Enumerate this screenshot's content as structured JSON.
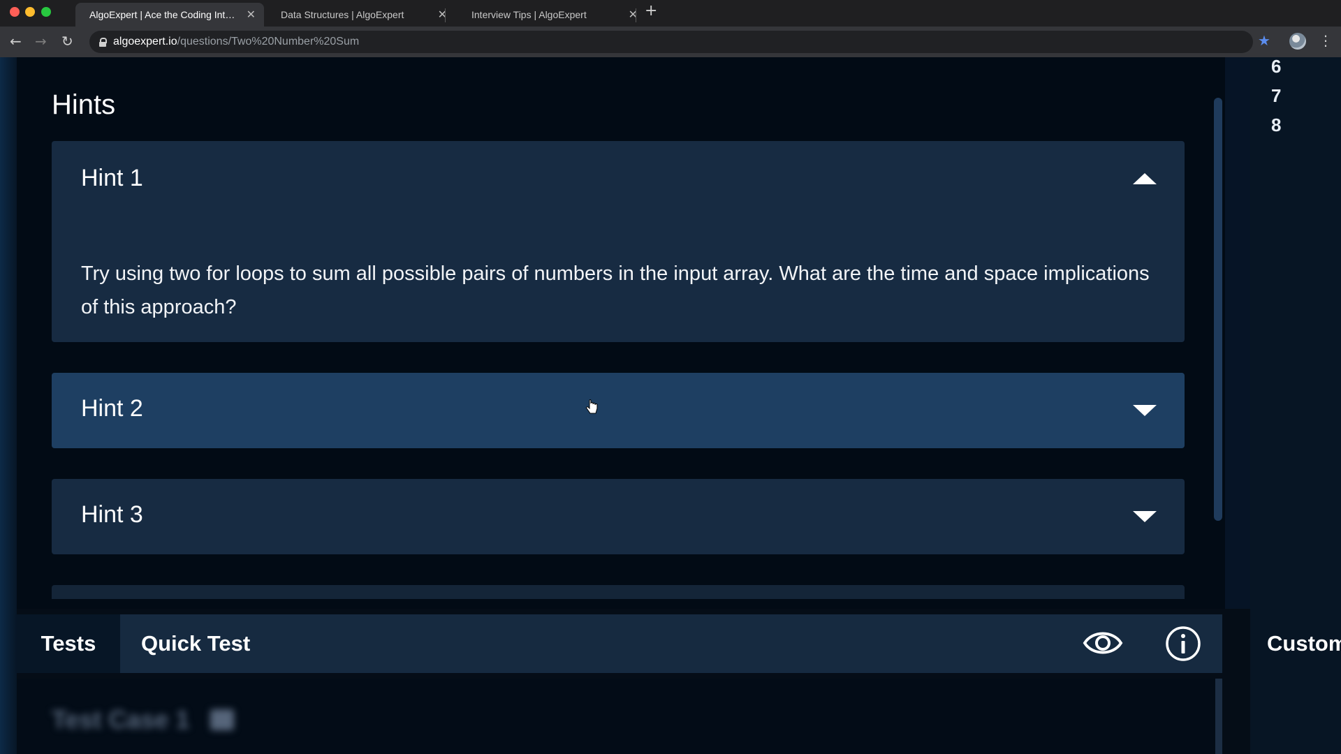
{
  "browser": {
    "tabs": [
      {
        "title": "AlgoExpert | Ace the Coding Interviews",
        "active": true
      },
      {
        "title": "Data Structures | AlgoExpert",
        "active": false
      },
      {
        "title": "Interview Tips | AlgoExpert",
        "active": false
      }
    ],
    "url_host": "algoexpert.io",
    "url_path": "/questions/Two%20Number%20Sum"
  },
  "hints": {
    "title": "Hints",
    "items": [
      {
        "label": "Hint 1",
        "expanded": true,
        "body": "Try using two for loops to sum all possible pairs of numbers in the input array. What are the time and space implications of this approach?"
      },
      {
        "label": "Hint 2",
        "expanded": false
      },
      {
        "label": "Hint 3",
        "expanded": false
      }
    ]
  },
  "editor": {
    "line_numbers": [
      "6",
      "7",
      "8"
    ]
  },
  "tests_panel": {
    "tabs": [
      "Tests",
      "Quick Test"
    ],
    "custom_label": "Custom",
    "blurred_case_label": "Test Case 1"
  },
  "colors": {
    "accent_blue": "#5b8def",
    "card_bg": "#172b42",
    "card_hover_bg": "#1e3f62",
    "page_bg": "#020b15"
  }
}
